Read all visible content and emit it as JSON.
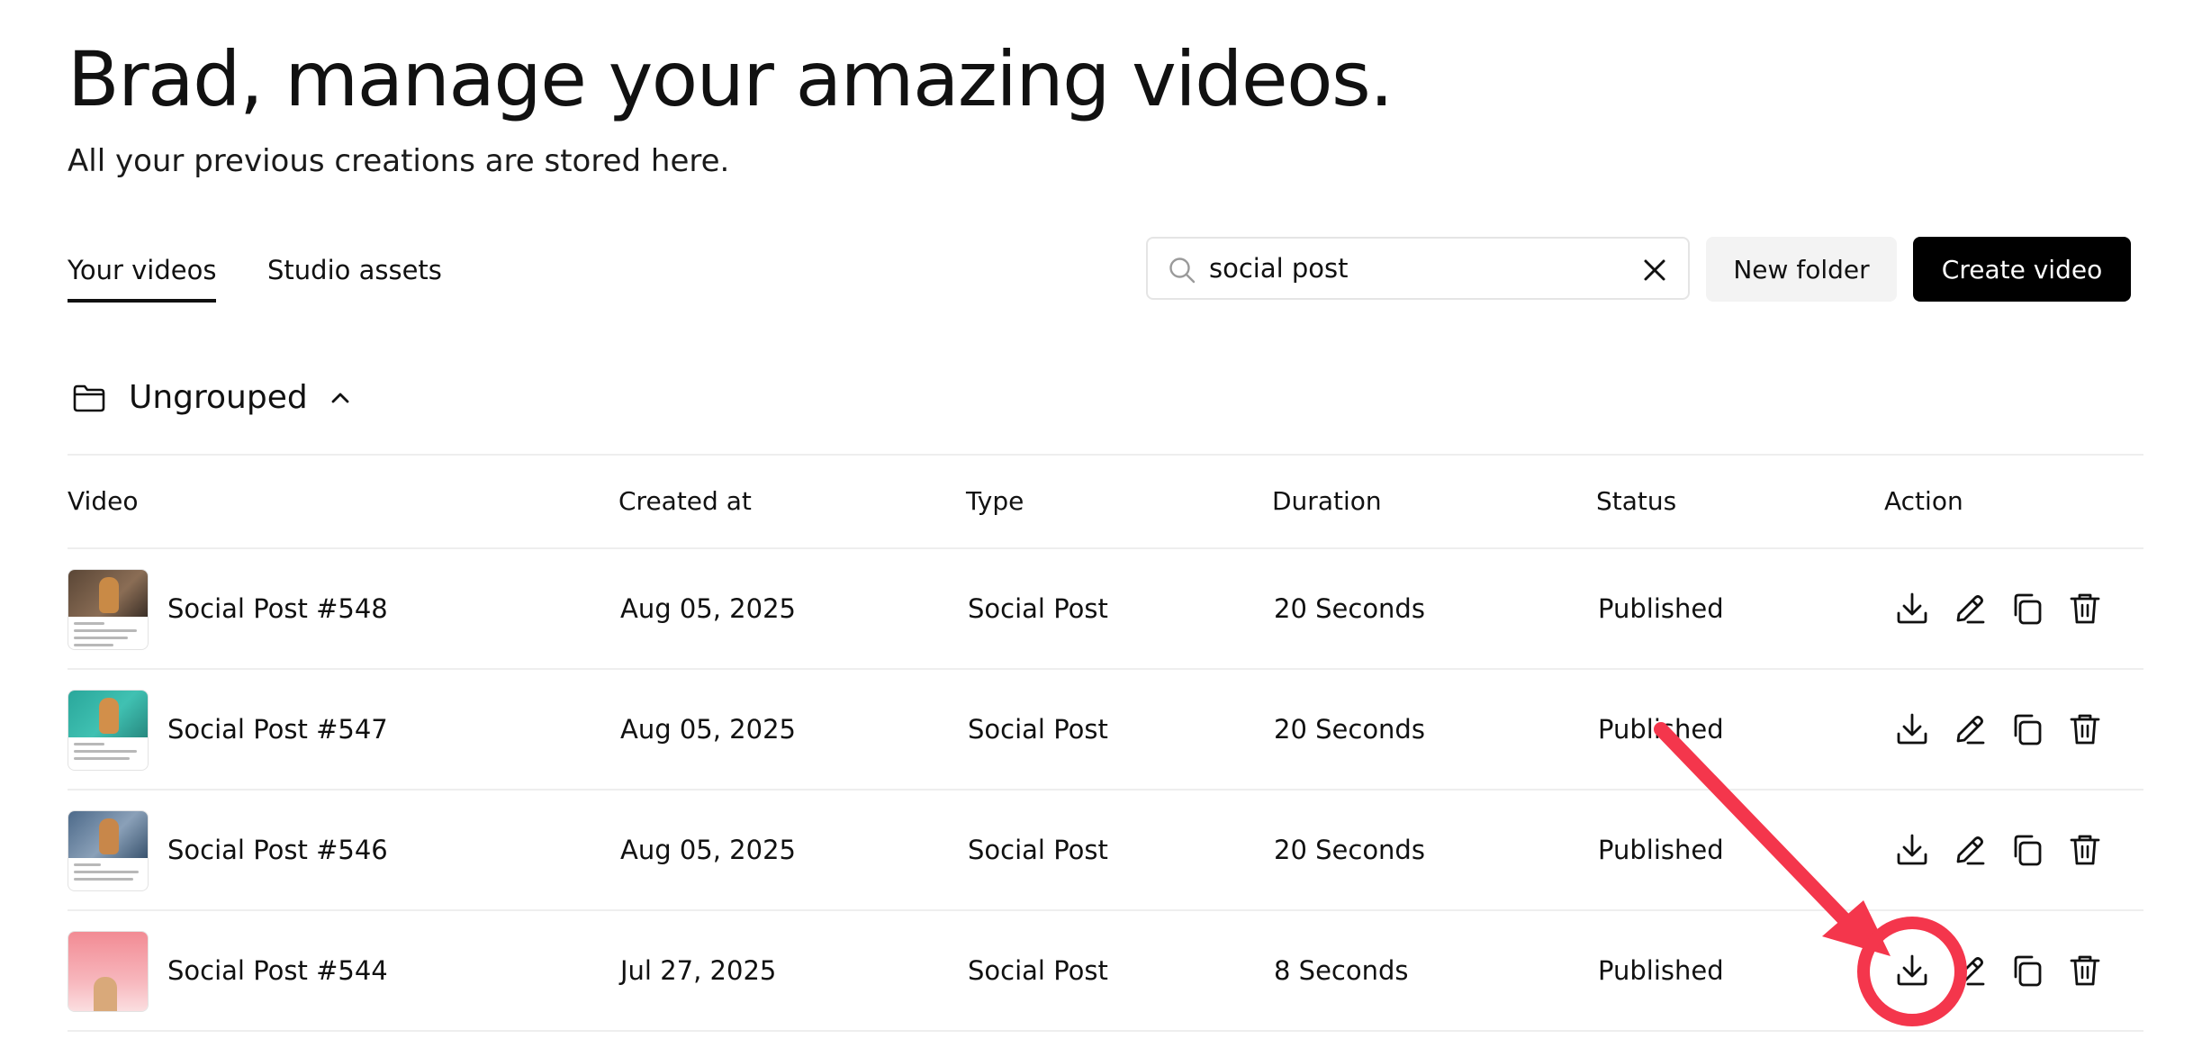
{
  "header": {
    "title": "Brad, manage your amazing videos.",
    "subtitle": "All your previous creations are stored here."
  },
  "tabs": [
    {
      "label": "Your videos",
      "active": true
    },
    {
      "label": "Studio assets",
      "active": false
    }
  ],
  "search": {
    "value": "social post",
    "icon": "search-icon",
    "clear_icon": "close-icon"
  },
  "toolbar": {
    "new_folder_label": "New folder",
    "create_video_label": "Create video"
  },
  "group": {
    "label": "Ungrouped",
    "icon": "folder-icon",
    "expanded": true
  },
  "table": {
    "columns": [
      "Video",
      "Created at",
      "Type",
      "Duration",
      "Status",
      "Action"
    ],
    "rows": [
      {
        "name": "Social Post #548",
        "created": "Aug 05, 2025",
        "type": "Social Post",
        "duration": "20 Seconds",
        "status": "Published"
      },
      {
        "name": "Social Post #547",
        "created": "Aug 05, 2025",
        "type": "Social Post",
        "duration": "20 Seconds",
        "status": "Published"
      },
      {
        "name": "Social Post #546",
        "created": "Aug 05, 2025",
        "type": "Social Post",
        "duration": "20 Seconds",
        "status": "Published"
      },
      {
        "name": "Social Post #544",
        "created": "Jul 27, 2025",
        "type": "Social Post",
        "duration": "8 Seconds",
        "status": "Published"
      }
    ],
    "actions": [
      "download-icon",
      "edit-icon",
      "duplicate-icon",
      "delete-icon"
    ]
  },
  "colors": {
    "primary_button": "#000000",
    "secondary_button": "#f3f3f3",
    "annotation": "#f4364c",
    "text": "#111111"
  }
}
